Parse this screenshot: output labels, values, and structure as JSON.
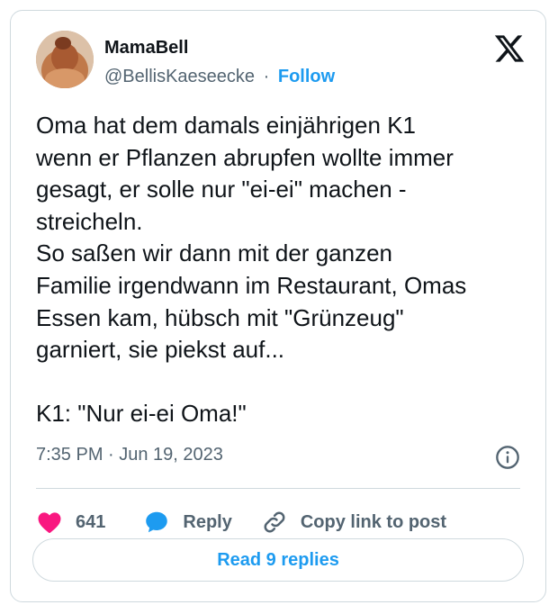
{
  "author": {
    "display_name": "MamaBell",
    "handle": "@BellisKaeseecke",
    "separator": "·",
    "follow_label": "Follow"
  },
  "tweet": {
    "text": "Oma hat dem damals einjährigen K1\nwenn er Pflanzen abrupfen wollte immer\ngesagt, er solle nur \"ei-ei\" machen -\nstreicheln.\nSo saßen wir dann mit der ganzen\nFamilie irgendwann im Restaurant, Omas\nEssen kam, hübsch mit \"Grünzeug\"\ngarniert, sie piekst auf...\n\nK1: \"Nur ei-ei Oma!\"",
    "timestamp": "7:35 PM · Jun 19, 2023"
  },
  "actions": {
    "like_count": "641",
    "reply_label": "Reply",
    "copy_link_label": "Copy link to post"
  },
  "read_replies_label": "Read 9 replies",
  "icons": {
    "platform": "x-logo-icon",
    "like": "heart-icon",
    "reply": "speech-bubble-icon",
    "copy": "link-icon",
    "info": "info-icon"
  },
  "colors": {
    "accent": "#1d9bf0",
    "like": "#f91880",
    "muted": "#536471",
    "text": "#0f1419",
    "border": "#cfd9de"
  }
}
